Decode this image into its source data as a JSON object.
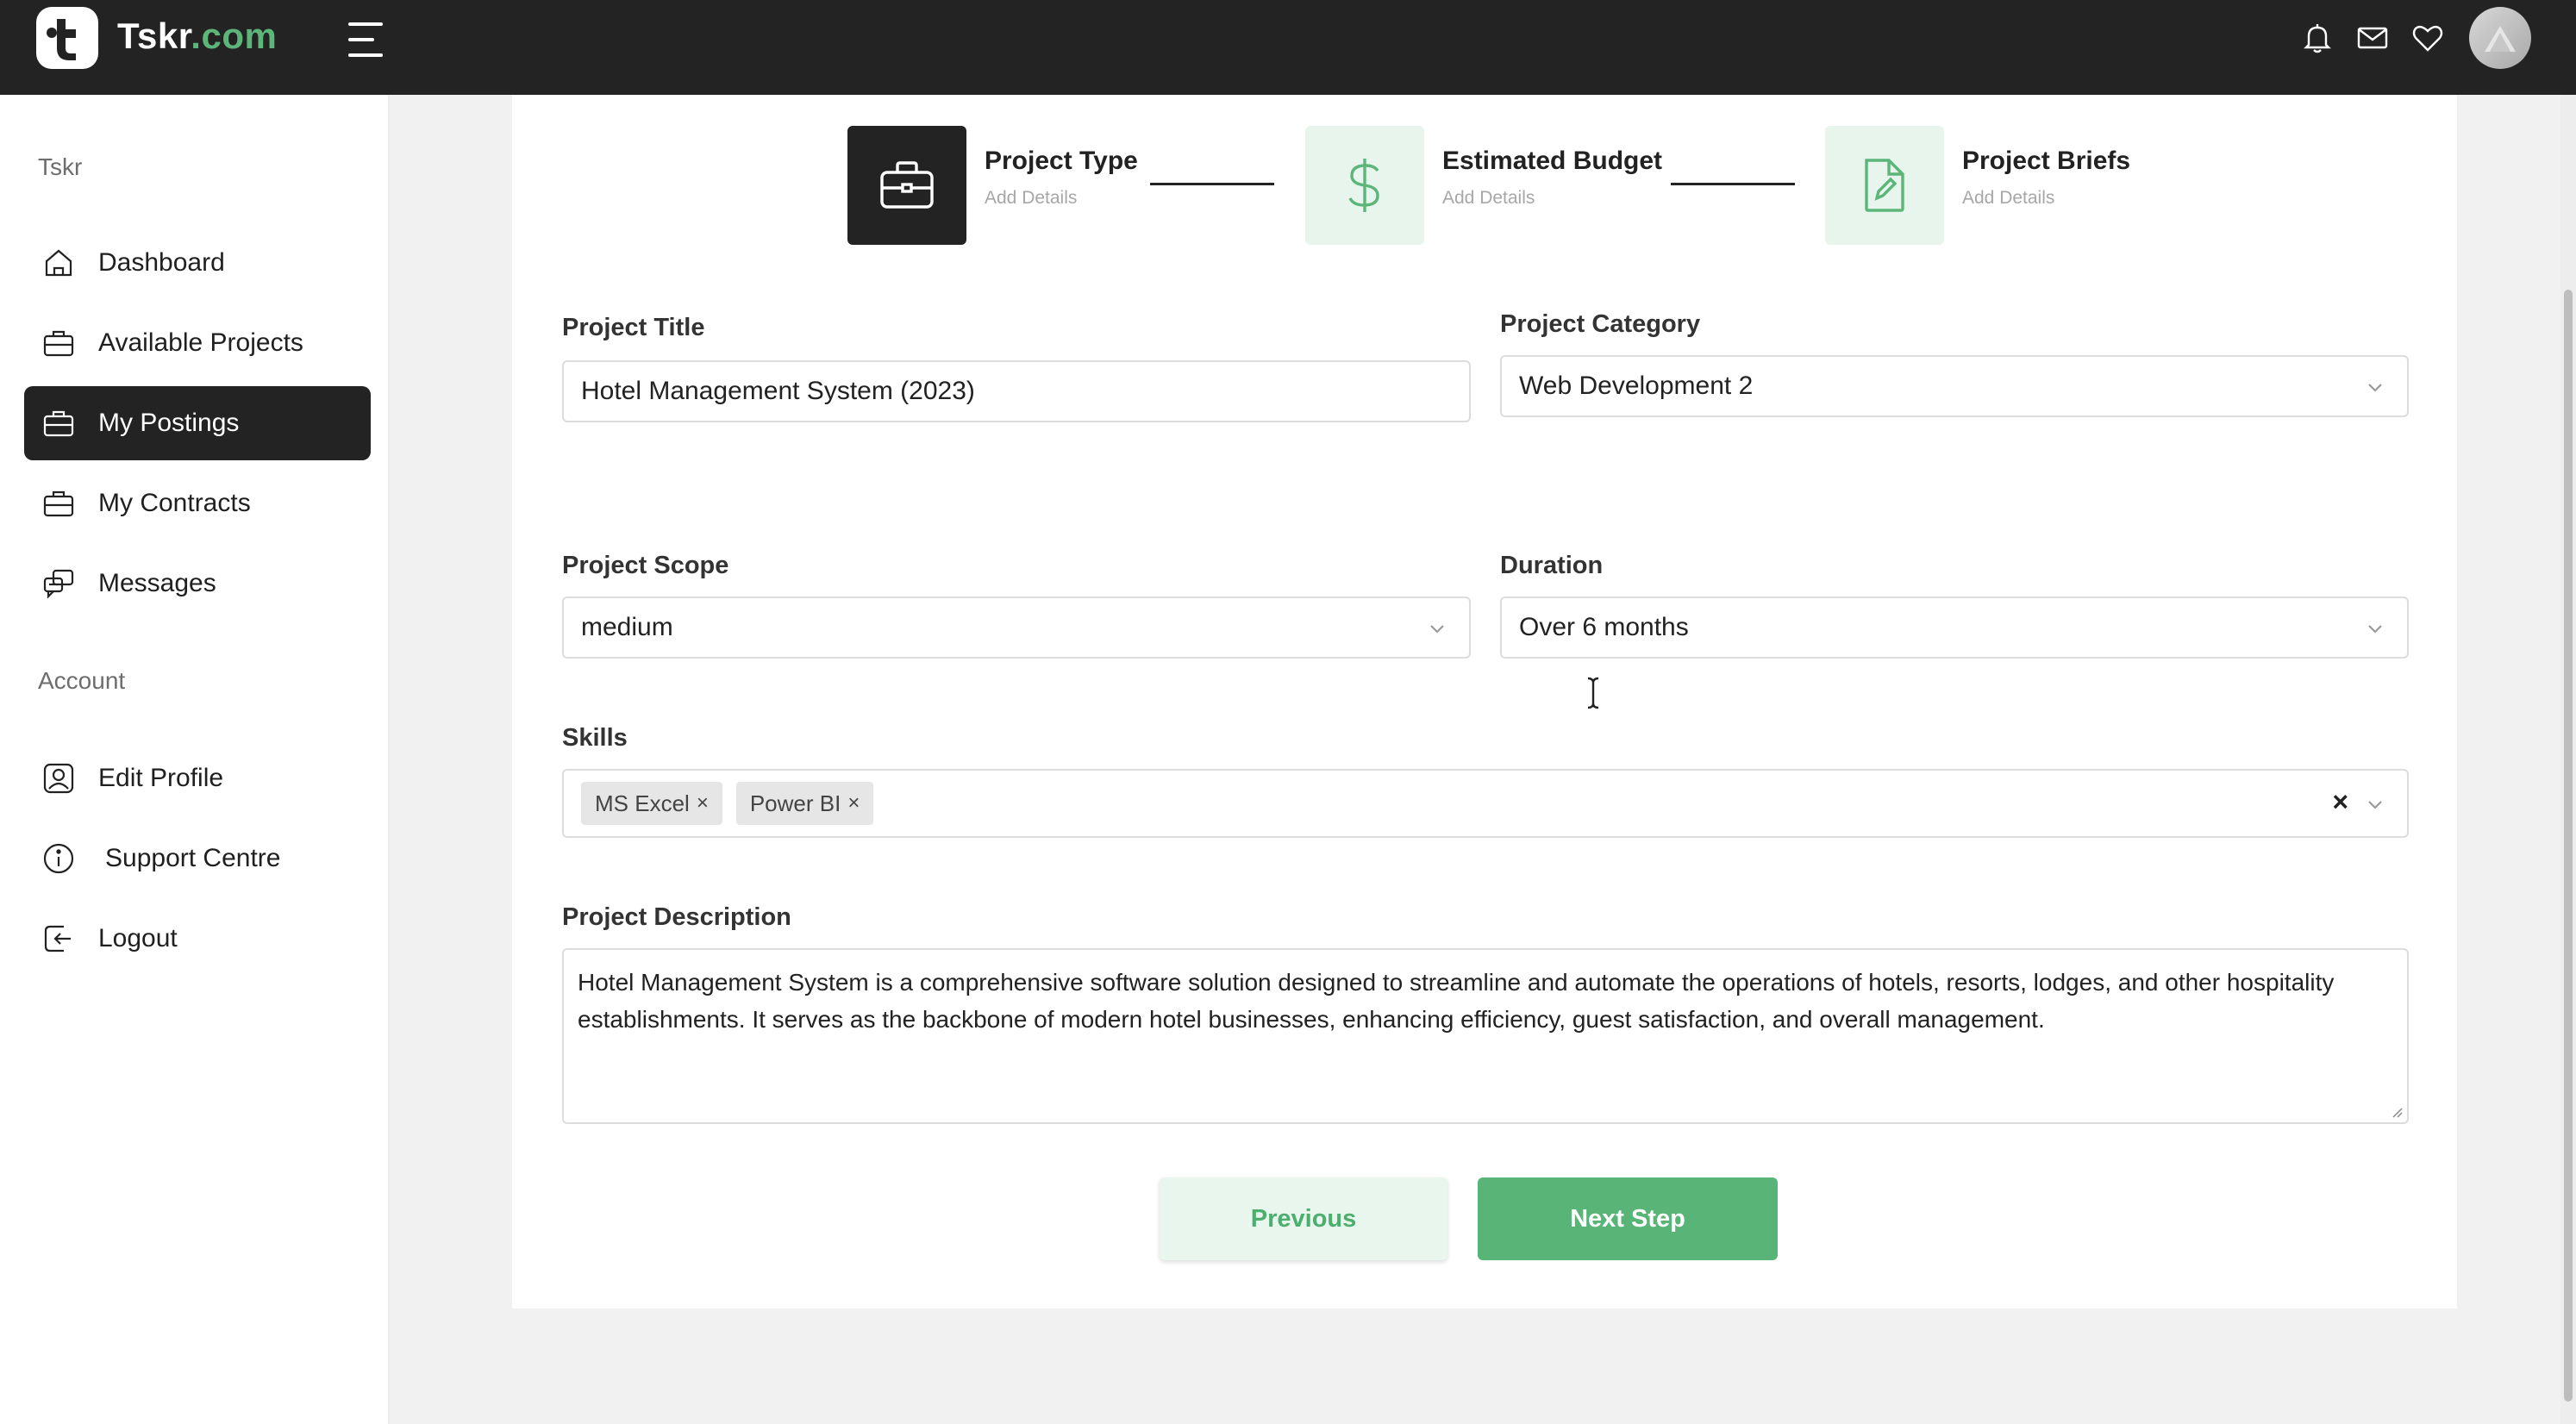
{
  "app": {
    "logo_main": "Tskr",
    "logo_domain": ".com"
  },
  "sidebar": {
    "section_main": "Tskr",
    "section_account": "Account",
    "items": [
      {
        "label": "Dashboard",
        "icon": "home-icon"
      },
      {
        "label": "Available Projects",
        "icon": "briefcase-icon"
      },
      {
        "label": "My Postings",
        "icon": "briefcase-icon",
        "active": true
      },
      {
        "label": "My Contracts",
        "icon": "briefcase-icon"
      },
      {
        "label": "Messages",
        "icon": "chat-icon"
      }
    ],
    "account_items": [
      {
        "label": "Edit Profile",
        "icon": "user-icon"
      },
      {
        "label": "Support Centre",
        "icon": "info-icon"
      },
      {
        "label": "Logout",
        "icon": "logout-icon"
      }
    ]
  },
  "steps": [
    {
      "title": "Project Type",
      "subtitle": "Add Details",
      "icon": "briefcase-icon",
      "active": true
    },
    {
      "title": "Estimated Budget",
      "subtitle": "Add Details",
      "icon": "dollar-icon",
      "active": false
    },
    {
      "title": "Project Briefs",
      "subtitle": "Add Details",
      "icon": "document-edit-icon",
      "active": false
    }
  ],
  "form": {
    "project_title": {
      "label": "Project Title",
      "value": "Hotel Management System (2023)"
    },
    "project_category": {
      "label": "Project Category",
      "value": "Web Development 2"
    },
    "project_scope": {
      "label": "Project Scope",
      "value": "medium"
    },
    "duration": {
      "label": "Duration",
      "value": "Over 6 months"
    },
    "skills": {
      "label": "Skills",
      "tags": [
        "MS Excel",
        "Power BI"
      ],
      "tag_remove": "×",
      "clear": "×"
    },
    "project_description": {
      "label": "Project Description",
      "value": "Hotel Management System is a comprehensive software solution designed to streamline and automate the operations of hotels, resorts, lodges, and other hospitality establishments. It serves as the backbone of modern hotel businesses, enhancing efficiency, guest satisfaction, and overall management."
    }
  },
  "buttons": {
    "previous": "Previous",
    "next": "Next Step"
  },
  "colors": {
    "accent_green": "#58b577",
    "dark": "#232323",
    "light_green": "#e7f5ec"
  }
}
